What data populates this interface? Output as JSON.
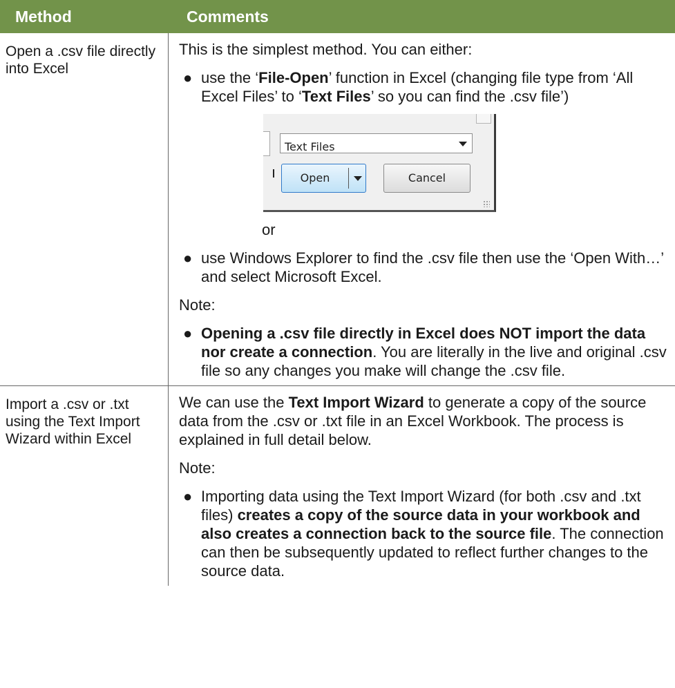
{
  "header": {
    "method": "Method",
    "comments": "Comments"
  },
  "row1": {
    "method": "Open a .csv file directly into Excel",
    "intro": "This is the simplest method. You can either:",
    "bullet1": {
      "t1": "use the ‘",
      "b1": "File-Open",
      "t2": "’ function in Excel (changing file type from ‘All Excel Files’ to ‘",
      "b2": "Text Files",
      "t3": "’ so you can find the .csv file’)"
    },
    "dialog": {
      "file_type": "Text Files",
      "open_label": "Open",
      "cancel_label": "Cancel"
    },
    "or": "or",
    "bullet2": "use Windows Explorer to find the .csv file then use the ‘Open With…’ and select Microsoft Excel.",
    "note": "Note:",
    "bullet3": {
      "b1": "Opening a .csv file directly in Excel does NOT import the data nor create a connection",
      "t1": ". You are literally in the live and original .csv file so any changes you make will change the .csv file."
    }
  },
  "row2": {
    "method": "Import a .csv or .txt using the Text Import Wizard within Excel",
    "p1": {
      "t1": "We can use the ",
      "b1": "Text Import Wizard",
      "t2": " to generate a copy of the source data from the .csv or .txt file in an Excel Workbook. The process is explained in full detail below."
    },
    "note": "Note:",
    "bullet1": {
      "t1": "Importing data using the Text Import Wizard (for both .csv and .txt files) ",
      "b1": "creates a copy of the source data in your workbook and also creates a connection back to the source file",
      "t2": ". The connection can then be subsequently updated to reflect further changes to the source data."
    }
  },
  "bullet_char": "●"
}
